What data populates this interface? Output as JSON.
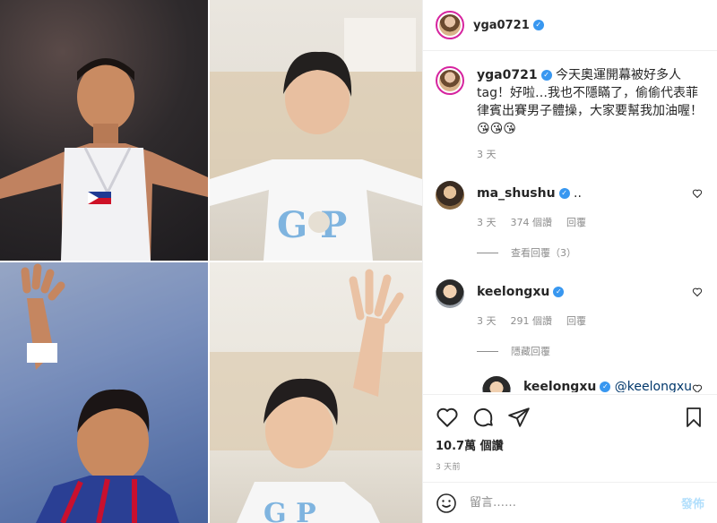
{
  "header": {
    "username": "yga0721",
    "verified": "✓"
  },
  "caption": {
    "username": "yga0721",
    "text": "今天奧運開幕被好多人tag！好啦…我也不隱瞞了，偷偷代表菲律賓出賽男子體操，大家要幫我加油喔！😘😘😘",
    "time": "3 天"
  },
  "comments": [
    {
      "username": "ma_shushu",
      "text": "..",
      "time": "3 天",
      "likes": "374 個讚",
      "reply": "回覆",
      "toggle": "查看回覆（3）"
    },
    {
      "username": "keelongxu",
      "text": "",
      "time": "3 天",
      "likes": "291 個讚",
      "reply": "回覆",
      "toggle": "隱藏回覆"
    }
  ],
  "reply": {
    "username": "keelongxu",
    "mention": "@keelongxu"
  },
  "post": {
    "likes": "10.7萬 個讚",
    "time": "3 天前"
  },
  "composer": {
    "placeholder": "留言……",
    "submit": "發佈"
  },
  "colors": {
    "accent": "#3897f0",
    "verified": "#3897f0",
    "post_button": "#b2dffc"
  }
}
